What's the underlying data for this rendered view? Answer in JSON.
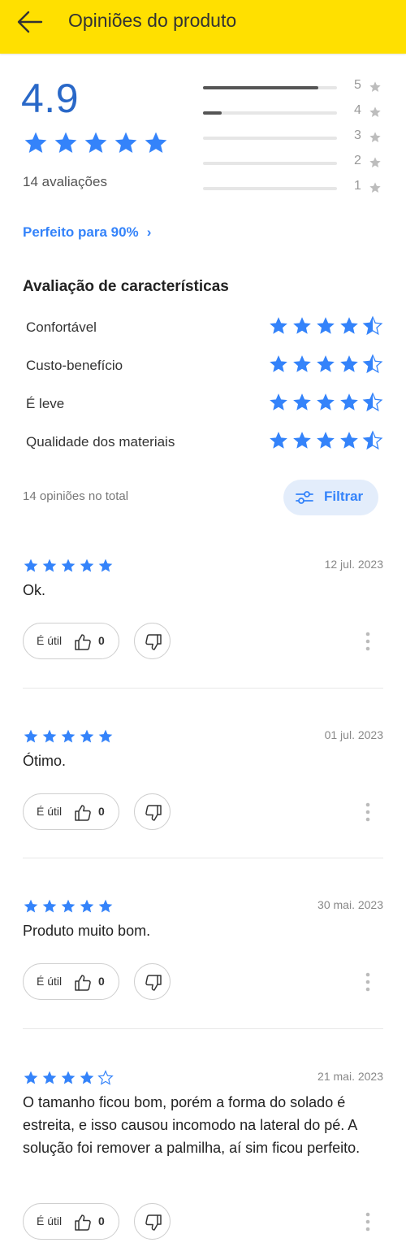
{
  "header": {
    "title": "Opiniões do produto",
    "back_icon": "arrow-left-icon"
  },
  "summary": {
    "score": "4.9",
    "stars": 5,
    "count_label": "14 avaliações",
    "distribution": [
      {
        "stars": "5",
        "fraction": 0.86
      },
      {
        "stars": "4",
        "fraction": 0.14
      },
      {
        "stars": "3",
        "fraction": 0
      },
      {
        "stars": "2",
        "fraction": 0
      },
      {
        "stars": "1",
        "fraction": 0
      }
    ]
  },
  "perfect_link": {
    "label": "Perfeito para 90%",
    "chevron": "›"
  },
  "features": {
    "title": "Avaliação de características",
    "items": [
      {
        "label": "Confortável",
        "rating": 4.5
      },
      {
        "label": "Custo-benefício",
        "rating": 4.5
      },
      {
        "label": "É leve",
        "rating": 4.5
      },
      {
        "label": "Qualidade dos materiais",
        "rating": 4.5
      }
    ]
  },
  "reviews_bar": {
    "total_label": "14 opiniões no total",
    "filter_label": "Filtrar",
    "filter_icon": "sliders-icon"
  },
  "reviews": [
    {
      "stars": 5,
      "date": "12 jul. 2023",
      "text": "Ok.",
      "useful_label": "É útil",
      "useful_count": "0"
    },
    {
      "stars": 5,
      "date": "01 jul. 2023",
      "text": "Ótimo.",
      "useful_label": "É útil",
      "useful_count": "0"
    },
    {
      "stars": 5,
      "date": "30 mai. 2023",
      "text": "Produto muito bom.",
      "useful_label": "É útil",
      "useful_count": "0"
    },
    {
      "stars": 4,
      "date": "21 mai. 2023",
      "text": "O tamanho ficou bom, porém a forma do solado é estreita, e isso causou incomodo na lateral do pé. A solução foi remover a palmilha, aí sim ficou perfeito.",
      "useful_label": "É útil",
      "useful_count": "0"
    }
  ],
  "colors": {
    "brand_yellow": "#ffe000",
    "accent_blue": "#3483fa",
    "score_blue": "#2968c8",
    "star_blue": "#3483fa"
  }
}
